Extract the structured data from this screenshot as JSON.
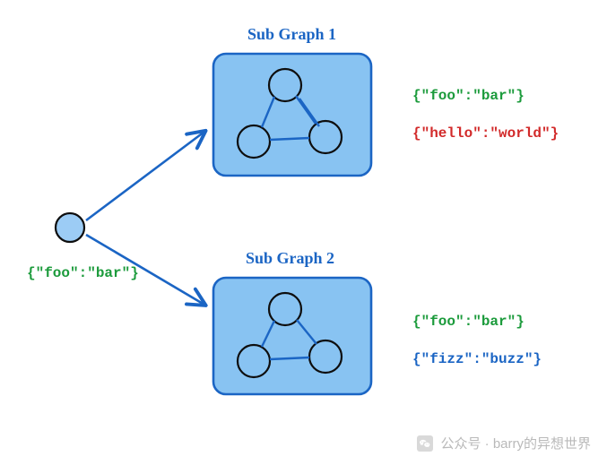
{
  "diagram": {
    "subgraph1": {
      "title": "Sub Graph 1"
    },
    "subgraph2": {
      "title": "Sub Graph 2"
    },
    "source_state": "{\"foo\":\"bar\"}",
    "out1_line1": "{\"foo\":\"bar\"}",
    "out1_line2": "{\"hello\":\"world\"}",
    "out2_line1": "{\"foo\":\"bar\"}",
    "out2_line2": "{\"fizz\":\"buzz\"}"
  },
  "watermark": {
    "prefix": "公众号 · ",
    "author": "barry的异想世界"
  },
  "colors": {
    "nodeFill": "#9cccf5",
    "nodeStroke": "#0e0e0e",
    "boxFill": "#88c3f2",
    "boxStroke": "#1b65c4",
    "arrow": "#1b65c4"
  }
}
